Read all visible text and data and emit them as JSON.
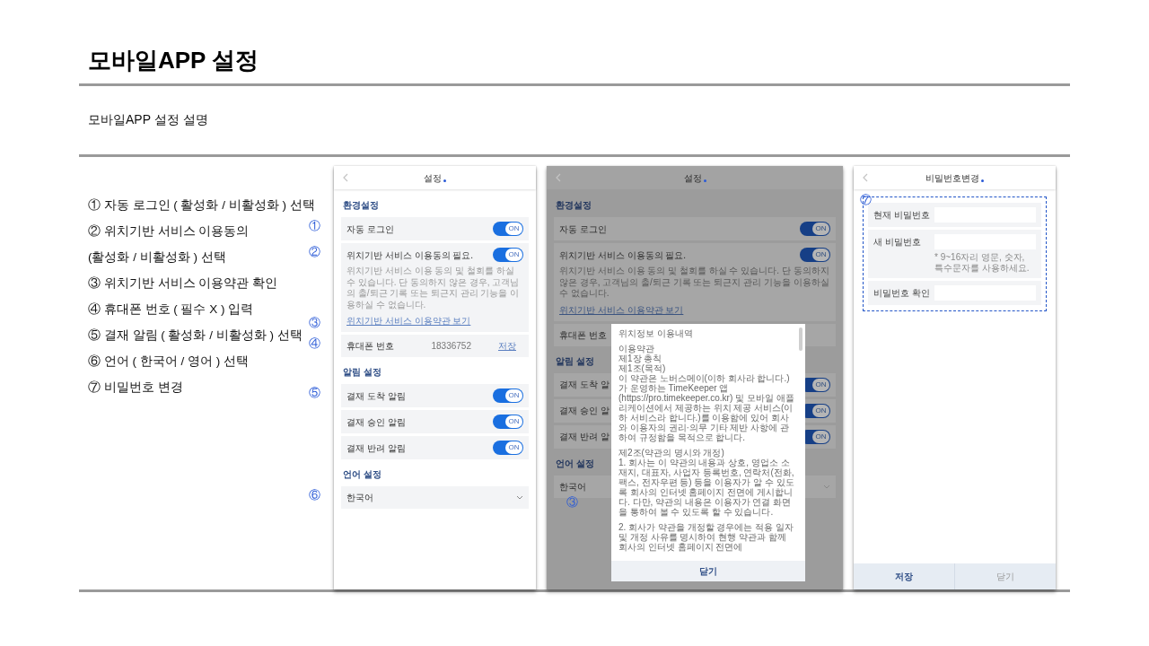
{
  "title": "모바일APP 설정",
  "subtitle": "모바일APP 설정 설명",
  "steps": [
    "① 자동 로그인 ( 활성화 / 비활성화 ) 선택",
    "② 위치기반 서비스 이용동의",
    "(활성화 / 비활성화 ) 선택",
    "③ 위치기반 서비스 이용약관 확인",
    "④ 휴대폰 번호 ( 필수 X ) 입력",
    "⑤ 결재 알림 ( 활성화 / 비활성화 ) 선택",
    "⑥ 언어 ( 한국어 / 영어 ) 선택",
    "⑦ 비밀번호 변경"
  ],
  "phones": [
    {
      "kind": "settings",
      "dimmed": false,
      "title": "설정",
      "sections": [
        {
          "label": "환경설정",
          "rows": [
            {
              "kind": "toggle",
              "label": "자동 로그인",
              "on": true,
              "toggle_text": "ON",
              "marker": "①"
            },
            {
              "kind": "consent",
              "label": "위치기반 서비스 이용동의 필요.",
              "on": true,
              "toggle_text": "ON",
              "description": "위치기반 서비스 이용 동의 및 철회를 하실 수 있습니다. 단 동의하지 않은 경우, 고객님의 출/퇴근 기록 또는 퇴근지 관리 기능을 이용하실 수 없습니다.",
              "link": "위치기반 서비스 이용약관 보기",
              "marker": "②",
              "link_marker": "③"
            },
            {
              "kind": "phone",
              "label": "휴대폰 번호",
              "value": "18336752",
              "action": "저장",
              "marker": "④"
            }
          ]
        },
        {
          "label": "알림 설정",
          "rows": [
            {
              "kind": "toggle",
              "label": "결재 도착 알림",
              "on": true,
              "toggle_text": "ON",
              "marker": "⑤"
            },
            {
              "kind": "toggle",
              "label": "결재 승인 알림",
              "on": true,
              "toggle_text": "ON"
            },
            {
              "kind": "toggle",
              "label": "결재 반려 알림",
              "on": true,
              "toggle_text": "ON"
            }
          ]
        },
        {
          "label": "언어 설정",
          "rows": [
            {
              "kind": "select",
              "value": "한국어",
              "marker": "⑥"
            }
          ]
        }
      ]
    },
    {
      "kind": "settings",
      "dimmed": true,
      "title": "설정",
      "marker": "③",
      "sections": [
        {
          "label": "환경설정",
          "rows": [
            {
              "kind": "toggle",
              "label": "자동 로그인",
              "on": true,
              "toggle_text": "ON"
            },
            {
              "kind": "consent",
              "label": "위치기반 서비스 이용동의 필요.",
              "on": true,
              "toggle_text": "ON",
              "description": "위치기반 서비스 이용 동의 및 철회를 하실 수 있습니다. 단 동의하지 않은 경우, 고객님의 출/퇴근 기록 또는 퇴근지 관리 기능을 이용하실 수 없습니다.",
              "link": "위치기반 서비스 이용약관 보기"
            },
            {
              "kind": "phone",
              "label": "휴대폰 번호"
            }
          ]
        },
        {
          "label": "알림 설정",
          "rows": [
            {
              "kind": "toggle",
              "label": "결재 도착 알",
              "on": true,
              "toggle_text": "ON"
            },
            {
              "kind": "toggle",
              "label": "결재 승인 알",
              "on": true,
              "toggle_text": "ON"
            },
            {
              "kind": "toggle",
              "label": "결재 반려 알",
              "on": true,
              "toggle_text": "ON"
            }
          ]
        },
        {
          "label": "언어 설정",
          "rows": [
            {
              "kind": "select",
              "value": "한국어"
            }
          ]
        }
      ],
      "modal": {
        "title": "위치정보 이용내역",
        "blocks": [
          [
            "이용약관",
            "제1장 총칙",
            "제1조(목적)",
            "이 약관은 노버스메이(이하 회사라 합니다.)가 운영하는 TimeKeeper 앱(https://pro.timekeeper.co.kr) 및 모바일 애플리케이션에서 제공하는 위치 제공 서비스(이하 서비스라 합니다.)를 이용함에 있어 회사와 이용자의 권리·의무 기타 제반 사항에 관하여 규정함을 목적으로 합니다."
          ],
          [
            "제2조(약관의 명시와 개정)",
            "1. 회사는 이 약관의 내용과 상호, 영업소 소재지, 대표자, 사업자 등록번호, 연락처(전화, 팩스, 전자우편 등) 등을 이용자가 알 수 있도록 회사의 인터넷 홈페이지 전면에 게시합니다. 다만, 약관의 내용은 이용자가 연결 화면을 통하여 볼 수 있도록 할 수 있습니다."
          ],
          [
            "2. 회사가 약관을 개정할 경우에는 적용 일자 및 개정 사유를 명시하여 현행 약관과 함께 회사의 인터넷 홈페이지 전면에"
          ]
        ],
        "button": "닫기"
      }
    },
    {
      "kind": "password",
      "title": "비밀번호변경",
      "marker": "⑦",
      "fields": [
        {
          "label": "현재 비밀번호"
        },
        {
          "label": "새 비밀번호",
          "hint": "* 9~16자리 영문, 숫자, 특수문자를 사용하세요."
        },
        {
          "label": "비밀번호 확인"
        }
      ],
      "buttons": [
        {
          "label": "저장",
          "primary": true
        },
        {
          "label": "닫기",
          "primary": false
        }
      ]
    }
  ]
}
